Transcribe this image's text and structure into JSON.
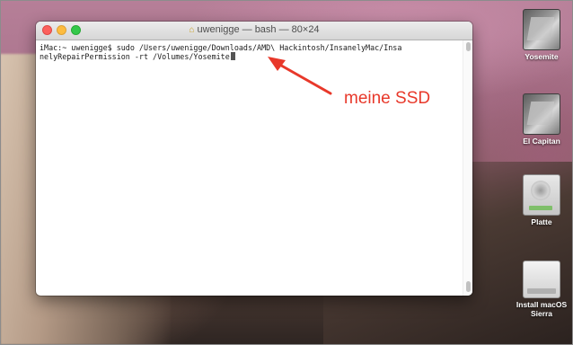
{
  "terminal": {
    "title": "uwenigge — bash — 80×24",
    "title_icon": "home-folder-icon",
    "line1": "iMac:~ uwenigge$ sudo /Users/uwenigge/Downloads/AMD\\ Hackintosh/InsanelyMac/Insa",
    "line2": "nelyRepairPermission -rt /Volumes/Yosemite"
  },
  "annotation": {
    "label": "meine SSD",
    "color": "#e8382a"
  },
  "desktop_icons": [
    {
      "label": "Yosemite",
      "icon": "ssd-drive-icon"
    },
    {
      "label": "El Capitan",
      "icon": "ssd-drive-icon"
    },
    {
      "label": "Platte",
      "icon": "hard-drive-icon"
    },
    {
      "label": "Install macOS Sierra",
      "icon": "installer-drive-icon"
    }
  ]
}
